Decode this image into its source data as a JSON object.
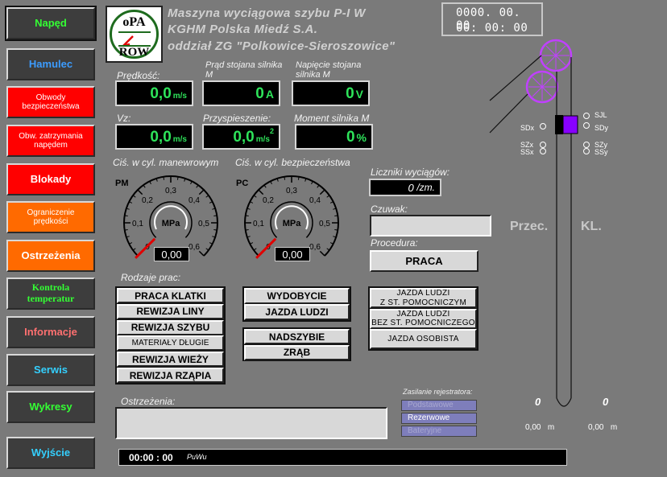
{
  "nav": [
    {
      "label": "Napęd",
      "color": "#34ff34",
      "bg": "#3d3d3d"
    },
    {
      "label": "Hamulec",
      "color": "#3c9cff",
      "bg": "#3d3d3d"
    },
    {
      "label": "Obwody\nbezpieczeństwa",
      "color": "#ffffff",
      "bg": "#ff0000"
    },
    {
      "label": "Obw. zatrzymania\nnapędem",
      "color": "#ffffff",
      "bg": "#ff0000"
    },
    {
      "label": "Blokady",
      "color": "#ffffff",
      "bg": "#ff0000"
    },
    {
      "label": "Ograniczenie\nprędkości",
      "color": "#ffffff",
      "bg": "#ff6a00"
    },
    {
      "label": "Ostrzeżenia",
      "color": "#ffffff",
      "bg": "#ff6a00"
    },
    {
      "label": "Kontrola\ntemperatur",
      "color": "#34ff34",
      "bg": "#3d3d3d"
    },
    {
      "label": "Informacje",
      "color": "#ff7070",
      "bg": "#3d3d3d"
    },
    {
      "label": "Serwis",
      "color": "#34d0ff",
      "bg": "#3d3d3d"
    },
    {
      "label": "Wykresy",
      "color": "#34ff34",
      "bg": "#3d3d3d"
    },
    {
      "label": "Wyjście",
      "color": "#34d0ff",
      "bg": "#3d3d3d"
    }
  ],
  "logo": {
    "top": "oPA",
    "bottom": "ROW"
  },
  "header": {
    "line1": "Maszyna wyciągowa szybu P-I W",
    "line2": "KGHM Polska Miedź S.A.",
    "line3": "oddział ZG \"Polkowice-Sieroszowice\""
  },
  "datetime": {
    "date": "0000. 00. 00",
    "time": "00: 00: 00"
  },
  "meters": {
    "speed": {
      "label": "Prędkość:",
      "value": "0,0",
      "unit": "m/s"
    },
    "current": {
      "label": "Prąd stojana silnika M",
      "value": "0",
      "unit": "A"
    },
    "voltage": {
      "label": "Napięcie stojana silnika M",
      "value": "0",
      "unit": "V"
    },
    "vz": {
      "label": "Vz:",
      "value": "0,0",
      "unit": "m/s"
    },
    "accel": {
      "label": "Przyspieszenie:",
      "value": "0,0",
      "unit": "m/s",
      "unit_sup": "2"
    },
    "torque": {
      "label": "Moment silnika M",
      "value": "0",
      "unit": "%"
    }
  },
  "gauges": {
    "pm": {
      "title": "Ciś. w cyl. manewrowym",
      "name": "PM",
      "unit": "MPa",
      "value": "0,00",
      "reading": 0,
      "ticks": [
        "0",
        "0,1",
        "0,2",
        "0,3",
        "0,4",
        "0,5",
        "0,6"
      ]
    },
    "pc": {
      "title": "Ciś. w cyl. bezpieczeństwa",
      "name": "PC",
      "unit": "MPa",
      "value": "0,00",
      "reading": 0,
      "ticks": [
        "0",
        "0,1",
        "0,2",
        "0,3",
        "0,4",
        "0,5",
        "0,6"
      ]
    }
  },
  "counters": {
    "label": "Liczniki wyciągów:",
    "value": "0",
    "unit": "/zm."
  },
  "czuwak": {
    "label": "Czuwak:",
    "value": ""
  },
  "procedura": {
    "label": "Procedura:",
    "value": "PRACA"
  },
  "work": {
    "label": "Rodzaje prac:",
    "col1": [
      "PRACA KLATKI",
      "REWIZJA LINY",
      "REWIZJA SZYBU",
      "MATERIAŁY DŁUGIE",
      "REWIZJA WIEŻY",
      "REWIZJA RZĄPIA"
    ],
    "col2a": [
      "WYDOBYCIE",
      "JAZDA LUDZI"
    ],
    "col2b": [
      "NADSZYBIE",
      "ZRĄB"
    ],
    "col3": [
      "JAZDA LUDZI\nZ ST. POMOCNICZYM",
      "JAZDA LUDZI\nBEZ ST. POMOCNICZEGO",
      "JAZDA OSOBISTA"
    ]
  },
  "warnings": {
    "label": "Ostrzeżenia:",
    "value": ""
  },
  "recorder": {
    "label": "Zasilanie rejestratora:",
    "options": [
      "Podstawowe",
      "Rezerwowe",
      "Bateryjne"
    ],
    "active": "Rezerwowe"
  },
  "shaft": {
    "left_label": "Przec.",
    "right_label": "KL.",
    "left_count": "0",
    "right_count": "0",
    "left_pos": "0,00",
    "right_pos": "0,00",
    "pos_unit": "m",
    "signals_left": [
      "SDx",
      "SZx",
      "SSx"
    ],
    "signals_right": [
      "SJL",
      "SDy",
      "SZy",
      "SSy"
    ]
  },
  "status": {
    "time": "00:00 : 00",
    "tag": "PиWи"
  },
  "colors": {
    "accent_green": "#2ee35a",
    "cage": "#8800ff",
    "wheel": "#c040ff"
  }
}
